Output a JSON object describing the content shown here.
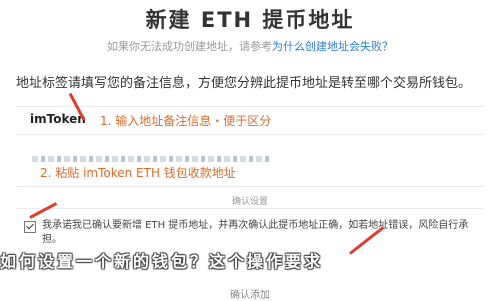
{
  "header": {
    "title": "新建 ETH 提币地址",
    "subtitle_prefix": "如果你无法成功创建地址，请参考",
    "subtitle_link": "为什么创建地址会失败？"
  },
  "description": "地址标签请填写您的备注信息，方便您分辨此提币地址是转至哪个交易所钱包。",
  "fields": {
    "brand": "imToken",
    "step1": "1. 输入地址备注信息・便于区分",
    "step2": "2. 粘贴 imToken ETH 钱包收款地址"
  },
  "section": {
    "heading": "确认设置"
  },
  "confirm": {
    "text": "我承诺我已确认要新增 ETH 提币地址，并再次确认此提币地址正确，如若地址错误，风险自行承担。"
  },
  "overlay_caption": "如何设置一个新的钱包？这个操作要求",
  "footer": {
    "button_label": "确认添加"
  },
  "colors": {
    "accent": "#2b7cd6",
    "annotation": "#e06a2a",
    "arrow": "#e23b2d"
  }
}
